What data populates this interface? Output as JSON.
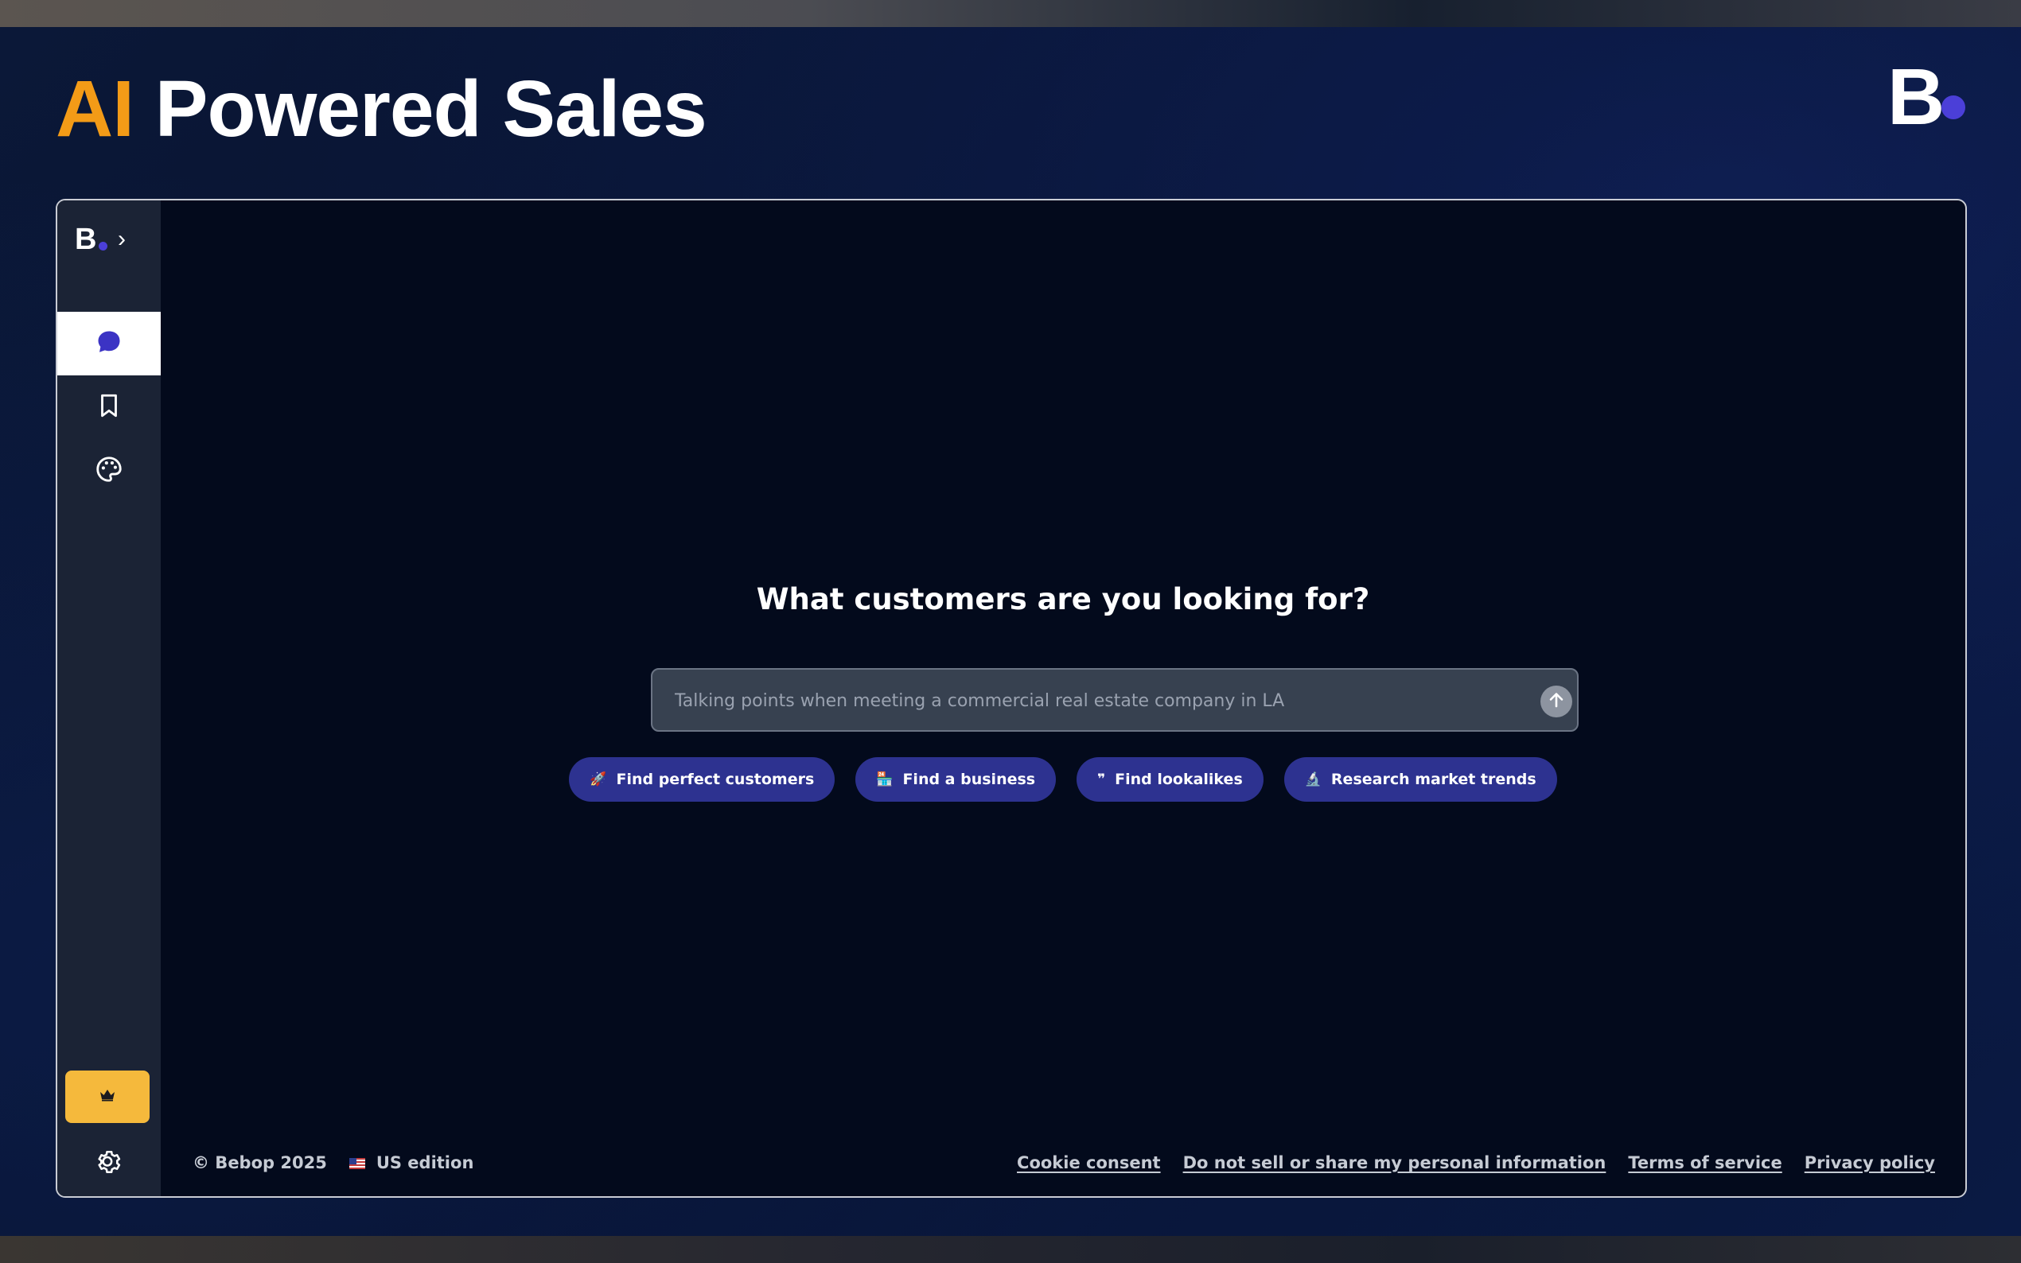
{
  "banner": {
    "headline_accent": "AI",
    "headline_rest": "Powered Sales",
    "brand_letter": "B",
    "accent_color": "#f39b17",
    "brand_dot_color": "#4b3fd8"
  },
  "sidebar": {
    "logo_letter": "B",
    "expand_icon": "chevron-right-icon",
    "items": [
      {
        "name": "chat",
        "icon": "chat-bubble-icon",
        "active": true
      },
      {
        "name": "saved",
        "icon": "bookmark-icon",
        "active": false
      },
      {
        "name": "theme",
        "icon": "palette-icon",
        "active": false
      }
    ],
    "upgrade_icon": "crown-icon",
    "upgrade_color": "#f5b93c",
    "settings_icon": "gear-icon"
  },
  "main": {
    "title": "What customers are you looking for?",
    "search": {
      "placeholder": "Talking points when meeting a commercial real estate company in LA",
      "value": "",
      "send_icon": "arrow-up-icon"
    },
    "chips": [
      {
        "icon": "rocket-icon",
        "glyph": "🚀",
        "label": "Find perfect customers"
      },
      {
        "icon": "storefront-icon",
        "glyph": "🏪",
        "label": "Find a business"
      },
      {
        "icon": "quote-icon",
        "glyph": "❞",
        "label": "Find lookalikes"
      },
      {
        "icon": "microscope-icon",
        "glyph": "🔬",
        "label": "Research market trends"
      }
    ],
    "chip_color": "#2d3290"
  },
  "footer": {
    "copyright": "© Bebop 2025",
    "edition": "US edition",
    "edition_icon": "us-flag-icon",
    "links": [
      "Cookie consent",
      "Do not sell or share my personal information",
      "Terms of service",
      "Privacy policy"
    ]
  }
}
